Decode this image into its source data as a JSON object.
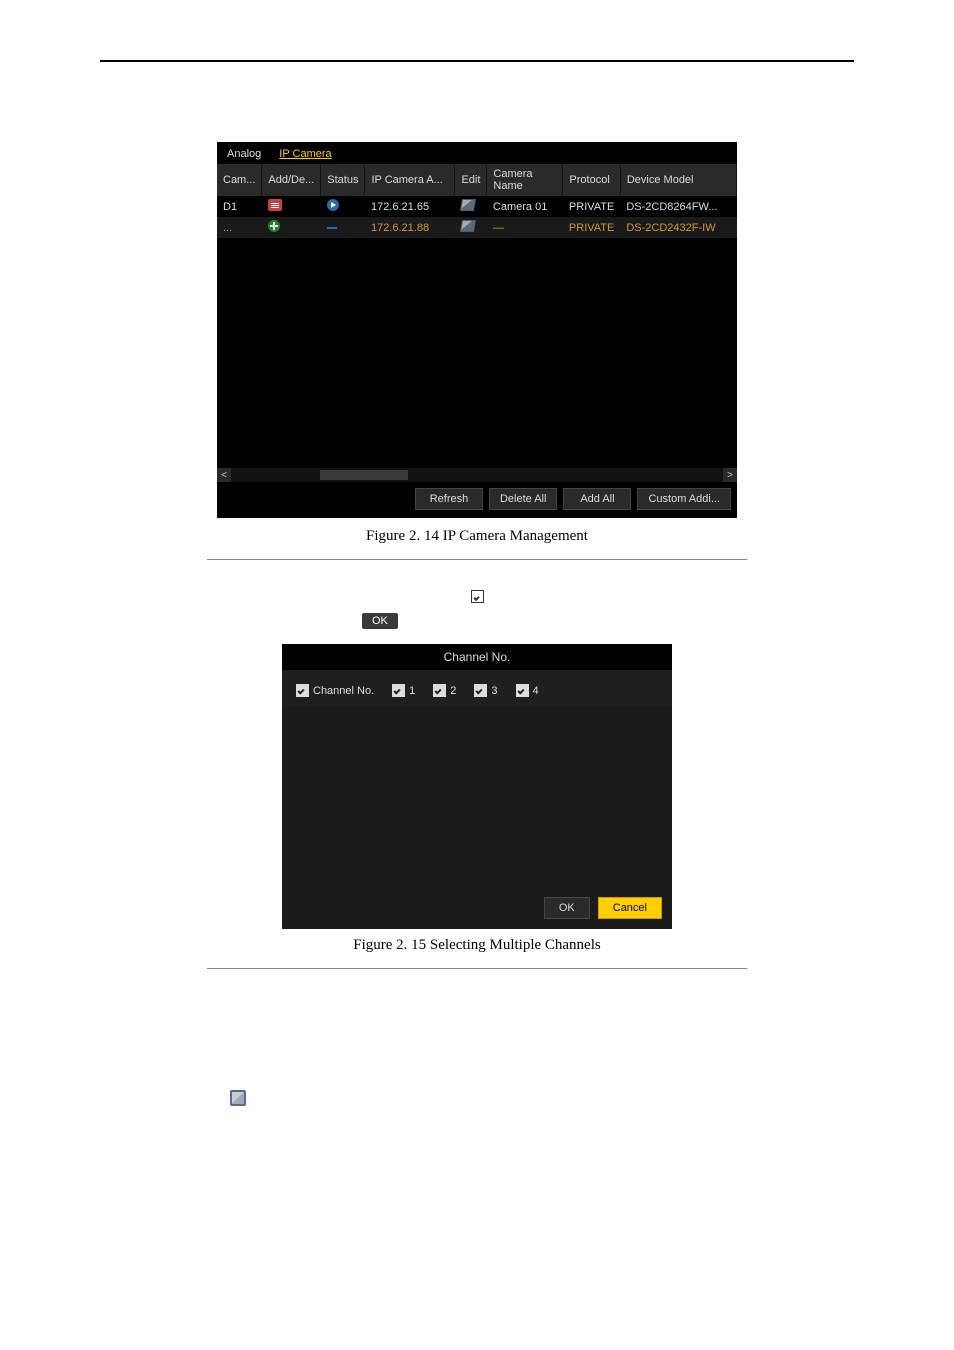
{
  "tabs": {
    "analog": "Analog",
    "ip": "IP Camera"
  },
  "table": {
    "headers": [
      "Cam...",
      "Add/De...",
      "Status",
      "IP Camera A...",
      "Edit",
      "Camera Name",
      "Protocol",
      "Device Model"
    ],
    "rows": [
      {
        "cam": "D1",
        "ip": "172.6.21.65",
        "name": "Camera 01",
        "proto": "PRIVATE",
        "model": "DS-2CD8264FW..."
      },
      {
        "cam": "...",
        "ip": "172.6.21.88",
        "name": "—",
        "proto": "PRIVATE",
        "model": "DS-2CD2432F-IW"
      }
    ]
  },
  "buttons": {
    "refresh": "Refresh",
    "deleteAll": "Delete All",
    "addAll": "Add All",
    "custom": "Custom Addi..."
  },
  "caption1": "Figure 2. 14 IP Camera Management",
  "caption2": "Figure 2. 15 Selecting Multiple Channels",
  "dialog": {
    "title": "Channel No.",
    "label": "Channel No.",
    "items": [
      "1",
      "2",
      "3",
      "4"
    ],
    "ok": "OK",
    "cancel": "Cancel"
  },
  "okTag": "OK"
}
